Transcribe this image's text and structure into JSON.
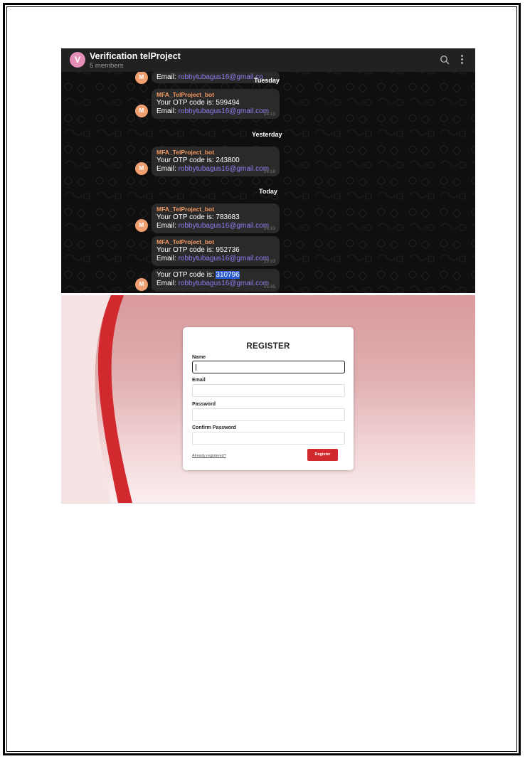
{
  "telegram": {
    "avatar_letter": "V",
    "group_title": "Verification telProject",
    "members": "5 members",
    "sender_avatar_letter": "M",
    "day_labels": [
      "Tuesday",
      "Yesterday",
      "Today"
    ],
    "messages": [
      {
        "sender": "",
        "otp_line": "",
        "email_label": "Email:",
        "email": "robbytubagus16@gmail.co",
        "time": ""
      },
      {
        "sender": "MFA_TelProject_bot",
        "otp_line": "Your OTP code is: 599494",
        "email_label": "Email:",
        "email": "robbytubagus16@gmail.com",
        "time": "14:13"
      },
      {
        "sender": "MFA_TelProject_bot",
        "otp_line": "Your OTP code is: 243800",
        "email_label": "Email:",
        "email": "robbytubagus16@gmail.com",
        "time": "14:18"
      },
      {
        "sender": "MFA_TelProject_bot",
        "otp_line": "Your OTP code is: 783683",
        "email_label": "Email:",
        "email": "robbytubagus16@gmail.com",
        "time": "14:33"
      },
      {
        "sender": "MFA_TelProject_bot",
        "otp_line": "Your OTP code is: 952736",
        "email_label": "Email:",
        "email": "robbytubagus16@gmail.com",
        "time": "15:33"
      },
      {
        "sender": "",
        "otp_prefix": "Your OTP code is:",
        "otp_highlight": "310796",
        "email_label": "Email:",
        "email": "robbytubagus16@gmail.com",
        "time": "15:35"
      }
    ]
  },
  "register": {
    "title": "REGISTER",
    "fields": [
      {
        "label": "Name",
        "value": ""
      },
      {
        "label": "Email",
        "value": ""
      },
      {
        "label": "Password",
        "value": ""
      },
      {
        "label": "Confirm Password",
        "value": ""
      }
    ],
    "already_link": "Already registered?",
    "submit_label": "Register",
    "accent_color": "#d2292e"
  }
}
